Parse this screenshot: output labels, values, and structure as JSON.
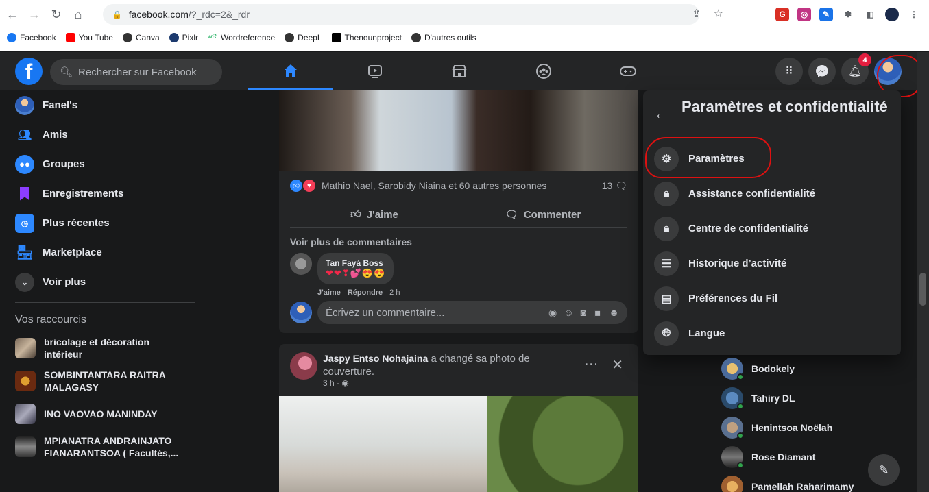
{
  "browser": {
    "url_host": "facebook.com",
    "url_path": "/?_rdc=2&_rdr",
    "bookmarks": [
      "Facebook",
      "You Tube",
      "Canva",
      "Pixlr",
      "Wordreference",
      "DeepL",
      "Thenounproject",
      "D'autres outils"
    ]
  },
  "header": {
    "search_placeholder": "Rechercher sur Facebook",
    "notification_count": "4"
  },
  "sidebar": {
    "items": [
      {
        "label": "Fanel's",
        "icon": "user-avatar"
      },
      {
        "label": "Amis",
        "icon": "friends-icon"
      },
      {
        "label": "Groupes",
        "icon": "groups-icon"
      },
      {
        "label": "Enregistrements",
        "icon": "bookmark-icon"
      },
      {
        "label": "Plus récentes",
        "icon": "recent-icon"
      },
      {
        "label": "Marketplace",
        "icon": "store-icon"
      },
      {
        "label": "Voir plus",
        "icon": "chevron-down-icon"
      }
    ],
    "shortcuts_title": "Vos raccourcis",
    "shortcuts": [
      {
        "line1": "bricolage et décoration",
        "line2": "intérieur"
      },
      {
        "line1": "SOMBINTANTARA RAITRA",
        "line2": "MALAGASY"
      },
      {
        "line1": "INO VAOVAO MANINDAY",
        "line2": ""
      },
      {
        "line1": "MPIANATRA ANDRAINJATO",
        "line2": "FIANARANTSOA ( Facultés,..."
      }
    ]
  },
  "post1": {
    "reactions_text": "Mathio Nael, Sarobidy Niaina et 60 autres personnes",
    "comments_count": "13",
    "like_label": "J'aime",
    "comment_label": "Commenter",
    "more_comments": "Voir plus de commentaires",
    "comment": {
      "author": "Tan Fayà Boss",
      "text": "❤❤❣💕😍😍",
      "like": "J'aime",
      "reply": "Répondre",
      "time": "2 h"
    },
    "write_placeholder": "Écrivez un commentaire..."
  },
  "post2": {
    "author": "Jaspy Entso Nohajaina",
    "action": "a changé sa photo de couverture.",
    "time": "3 h · ◉"
  },
  "settings_menu": {
    "title": "Paramètres et confidentialité",
    "items": [
      {
        "label": "Paramètres",
        "icon": "gear-icon"
      },
      {
        "label": "Assistance confidentialité",
        "icon": "lock-star-icon"
      },
      {
        "label": "Centre de confidentialité",
        "icon": "lock-icon"
      },
      {
        "label": "Historique d’activité",
        "icon": "list-icon"
      },
      {
        "label": "Préférences du Fil",
        "icon": "feed-icon"
      },
      {
        "label": "Langue",
        "icon": "globe-icon"
      }
    ]
  },
  "contacts": [
    {
      "name": "Bodokely"
    },
    {
      "name": "Tahiry DL"
    },
    {
      "name": "Henintsoa Noëlah"
    },
    {
      "name": "Rose Diamant"
    },
    {
      "name": "Pamellah Raharimamy"
    }
  ],
  "colors": {
    "accent": "#2d88ff",
    "annotation_red": "#dd1111",
    "badge": "#e41e3f"
  }
}
